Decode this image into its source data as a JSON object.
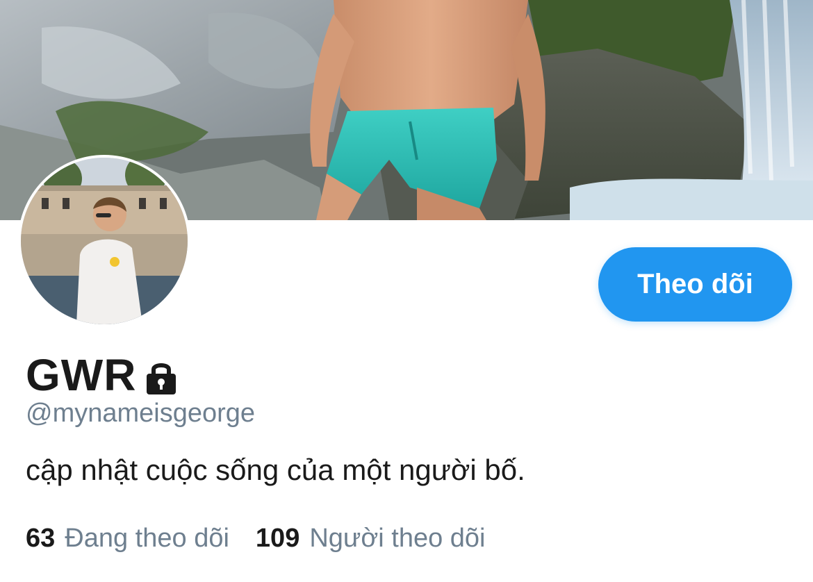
{
  "profile": {
    "display_name": "GWR",
    "handle": "@mynameisgeorge",
    "bio": "cập nhật cuộc sống của một người bố.",
    "protected_icon": "lock-icon"
  },
  "actions": {
    "follow_label": "Theo dõi"
  },
  "stats": {
    "following_count": "63",
    "following_label": "Đang theo dõi",
    "followers_count": "109",
    "followers_label": "Người theo dõi"
  },
  "colors": {
    "accent": "#2196f0",
    "text_primary": "#1a1a1a",
    "text_secondary": "#6e7f8f"
  }
}
